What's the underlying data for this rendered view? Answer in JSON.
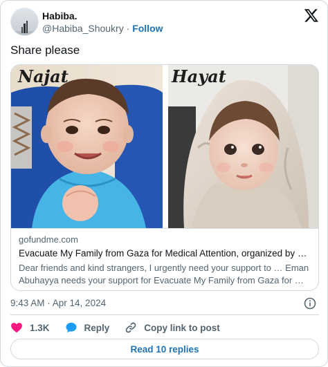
{
  "author": {
    "name": "Habiba.",
    "handle": "@Habiba_Shoukry",
    "separator": "·",
    "follow_label": "Follow"
  },
  "tweet": {
    "text": "Share please"
  },
  "card": {
    "image_labels": [
      "Najat",
      "Hayat"
    ],
    "domain": "gofundme.com",
    "title": "Evacuate My Family from Gaza for Medical Attention, organized by Em…",
    "description_line1": "Dear friends and kind strangers, I urgently need your support to … Eman",
    "description_line2": "Abuhayya needs your support for Evacuate My Family from Gaza for …"
  },
  "meta": {
    "timestamp": "9:43 AM · Apr 14, 2024"
  },
  "actions": {
    "like_count": "1.3K",
    "reply_label": "Reply",
    "copy_label": "Copy link to post"
  },
  "read_replies_label": "Read 10 replies",
  "icons": {
    "brand": "x-logo-icon",
    "info": "info-icon",
    "like": "heart-icon",
    "reply": "speech-bubble-icon",
    "copy": "link-icon"
  },
  "colors": {
    "link_blue": "#1d73b8",
    "like_pink": "#f91880",
    "reply_blue": "#1d9bf0",
    "muted_text": "#536471",
    "border": "#cfd9de"
  }
}
